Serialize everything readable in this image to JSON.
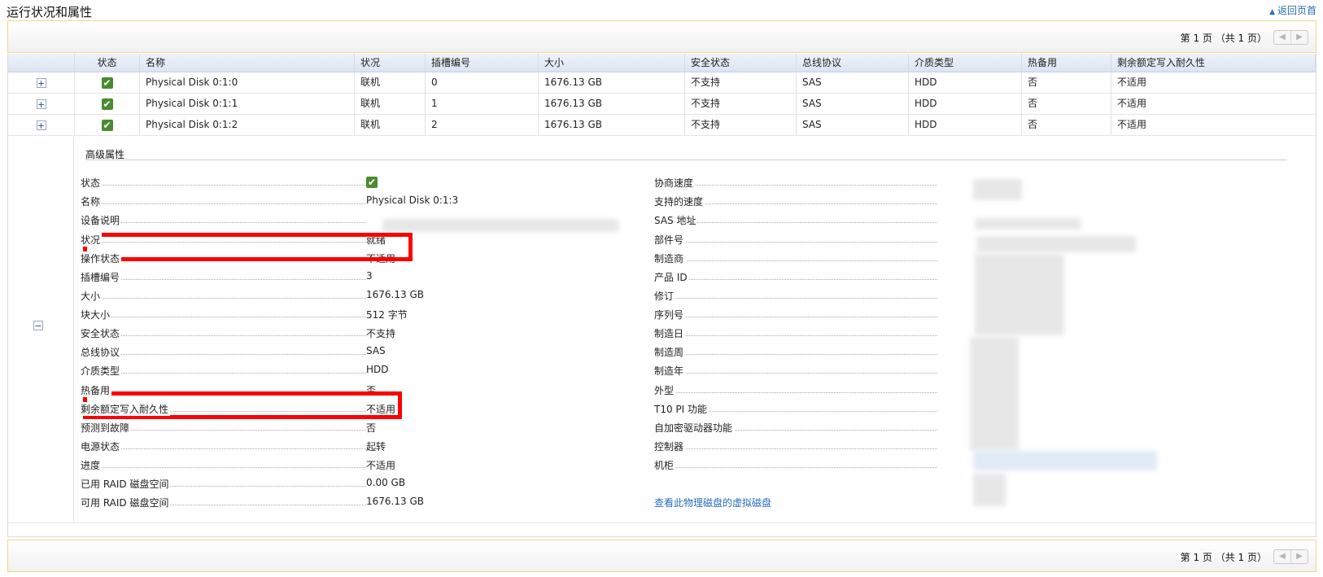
{
  "page": {
    "title": "运行状况和属性",
    "back_link": "返回页首"
  },
  "pager": {
    "text": "第 1 页 （共 1 页）",
    "prev": "◀",
    "next": "▶"
  },
  "table": {
    "headers": [
      "",
      "状态",
      "名称",
      "状况",
      "插槽编号",
      "大小",
      "安全状态",
      "总线协议",
      "介质类型",
      "热备用",
      "剩余额定写入耐久性"
    ],
    "expand_symbol": "+",
    "collapse_symbol": "−",
    "rows": [
      {
        "name": "Physical Disk 0:1:0",
        "condition": "联机",
        "slot": "0",
        "size": "1676.13 GB",
        "security": "不支持",
        "bus": "SAS",
        "media": "HDD",
        "hotspare": "否",
        "endurance": "不适用"
      },
      {
        "name": "Physical Disk 0:1:1",
        "condition": "联机",
        "slot": "1",
        "size": "1676.13 GB",
        "security": "不支持",
        "bus": "SAS",
        "media": "HDD",
        "hotspare": "否",
        "endurance": "不适用"
      },
      {
        "name": "Physical Disk 0:1:2",
        "condition": "联机",
        "slot": "2",
        "size": "1676.13 GB",
        "security": "不支持",
        "bus": "SAS",
        "media": "HDD",
        "hotspare": "否",
        "endurance": "不适用"
      }
    ]
  },
  "advanced": {
    "title": "高级属性",
    "left": [
      {
        "label": "状态",
        "value": ""
      },
      {
        "label": "名称",
        "value": "Physical Disk 0:1:3"
      },
      {
        "label": "设备说明",
        "value": ""
      },
      {
        "label": "状况",
        "value": "就绪"
      },
      {
        "label": "操作状态",
        "value": "不适用"
      },
      {
        "label": "插槽编号",
        "value": "3"
      },
      {
        "label": "大小",
        "value": "1676.13 GB"
      },
      {
        "label": "块大小",
        "value": "512 字节"
      },
      {
        "label": "安全状态",
        "value": "不支持"
      },
      {
        "label": "总线协议",
        "value": "SAS"
      },
      {
        "label": "介质类型",
        "value": "HDD"
      },
      {
        "label": "热备用",
        "value": "否"
      },
      {
        "label": "剩余额定写入耐久性",
        "value": "不适用"
      },
      {
        "label": "预测到故障",
        "value": "否"
      },
      {
        "label": "电源状态",
        "value": "起转"
      },
      {
        "label": "进度",
        "value": "不适用"
      },
      {
        "label": "已用 RAID 磁盘空间",
        "value": "0.00 GB"
      },
      {
        "label": "可用 RAID 磁盘空间",
        "value": "1676.13 GB"
      }
    ],
    "right": [
      {
        "label": "协商速度"
      },
      {
        "label": "支持的速度"
      },
      {
        "label": "SAS 地址"
      },
      {
        "label": "部件号"
      },
      {
        "label": "制造商"
      },
      {
        "label": "产品 ID"
      },
      {
        "label": "修订"
      },
      {
        "label": "序列号"
      },
      {
        "label": "制造日"
      },
      {
        "label": "制造周"
      },
      {
        "label": "制造年"
      },
      {
        "label": "外型"
      },
      {
        "label": "T10 PI 功能"
      },
      {
        "label": "自加密驱动器功能"
      },
      {
        "label": "控制器"
      },
      {
        "label": "机柜"
      }
    ],
    "virtual_disk_link": "查看此物理磁盘的虚拟磁盘"
  },
  "colors": {
    "highlight": "#ff0000",
    "check_green": "#4b8a32",
    "link_blue": "#2a6ebb",
    "pager_border": "#f1d88a"
  }
}
